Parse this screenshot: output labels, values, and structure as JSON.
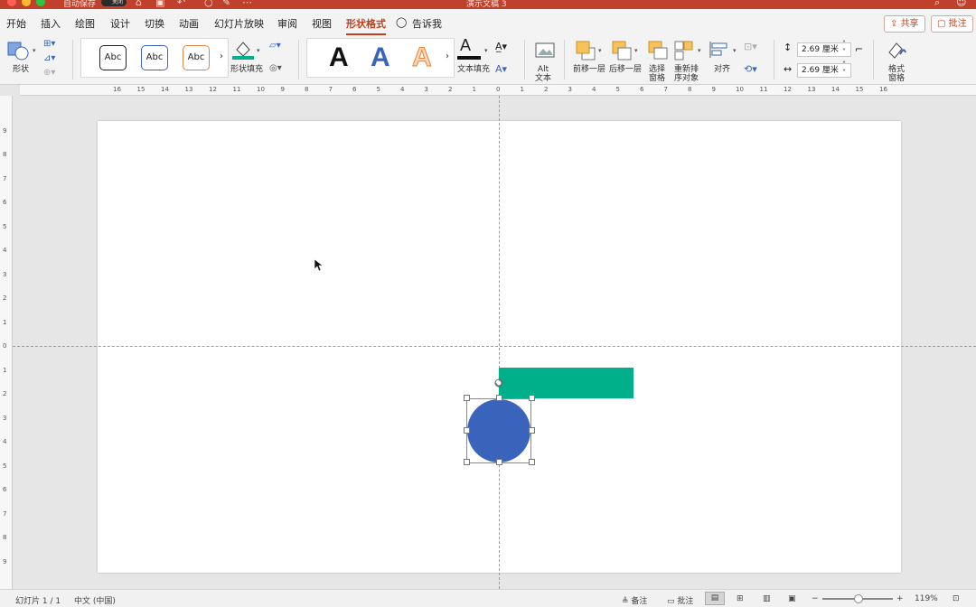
{
  "window": {
    "title": "演示文稿 3",
    "autosave_label": "自动保存",
    "autosave_state": "关闭"
  },
  "tabs": [
    "开始",
    "插入",
    "绘图",
    "设计",
    "切换",
    "动画",
    "幻灯片放映",
    "审阅",
    "视图",
    "形状格式"
  ],
  "active_tab": "形状格式",
  "tell_me": "告诉我",
  "share_label": "共享",
  "comments_label": "批注",
  "ribbon": {
    "shapes_label": "形状",
    "style_samples": [
      "Abc",
      "Abc",
      "Abc"
    ],
    "shape_fill_label": "形状填充",
    "wordart_sample": "A",
    "text_fill_label": "文本填充",
    "alt_text_label": "Alt\n文本",
    "bring_forward_label": "前移一层",
    "send_backward_label": "后移一层",
    "selection_pane_label": "选择\n窗格",
    "reorder_objects_label": "重新排\n序对象",
    "align_label": "对齐",
    "height_value": "2.69 厘米",
    "width_value": "2.69 厘米",
    "format_pane_label": "格式\n窗格"
  },
  "ruler_labels": [
    "16",
    "15",
    "14",
    "13",
    "12",
    "11",
    "10",
    "9",
    "8",
    "7",
    "6",
    "5",
    "4",
    "3",
    "2",
    "1",
    "0",
    "1",
    "2",
    "3",
    "4",
    "5",
    "6",
    "7",
    "8",
    "9",
    "10",
    "11",
    "12",
    "13",
    "14",
    "15",
    "16"
  ],
  "vruler_labels": [
    "9",
    "8",
    "7",
    "6",
    "5",
    "4",
    "3",
    "2",
    "1",
    "0",
    "1",
    "2",
    "3",
    "4",
    "5",
    "6",
    "7",
    "8",
    "9"
  ],
  "colors": {
    "title_bar": "#c0402b",
    "accent": "#c43e1c",
    "rectangle_fill": "#00b08a",
    "circle_fill": "#3a64bc"
  },
  "status": {
    "slide_counter": "幻灯片 1 / 1",
    "language": "中文 (中国)",
    "notes_label": "备注",
    "comments_label": "批注",
    "zoom": "119%"
  }
}
